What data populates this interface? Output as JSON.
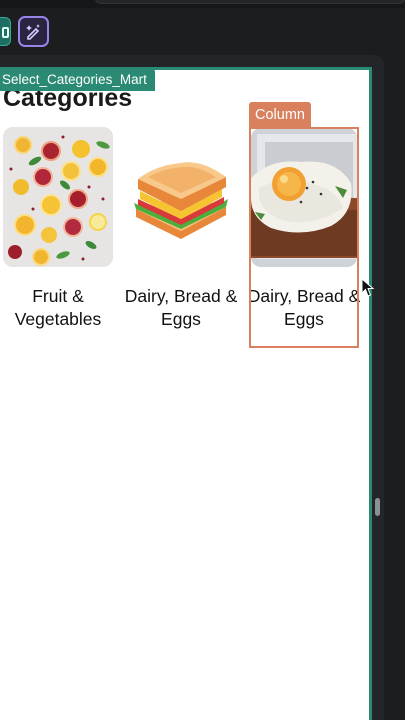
{
  "toolbar": {
    "tools": [
      {
        "name": "component-tool",
        "icon": "page-icon",
        "active": true
      },
      {
        "name": "ai-tool",
        "icon": "sparkle-pen-icon",
        "active": false
      }
    ]
  },
  "canvas": {
    "component_name": "Select_Categories_Mart",
    "heading": "Categories",
    "selection_label": "Column",
    "accent_color": "#2a8a73",
    "selection_color": "#d9805d"
  },
  "categories": [
    {
      "label": "Fruit & Vegetables",
      "image": "citrus-fruits-image"
    },
    {
      "label": "Dairy, Bread & Eggs",
      "image": "sandwich-image"
    },
    {
      "label": "Dairy, Bread & Eggs",
      "image": "egg-toast-image",
      "selected": true
    }
  ]
}
